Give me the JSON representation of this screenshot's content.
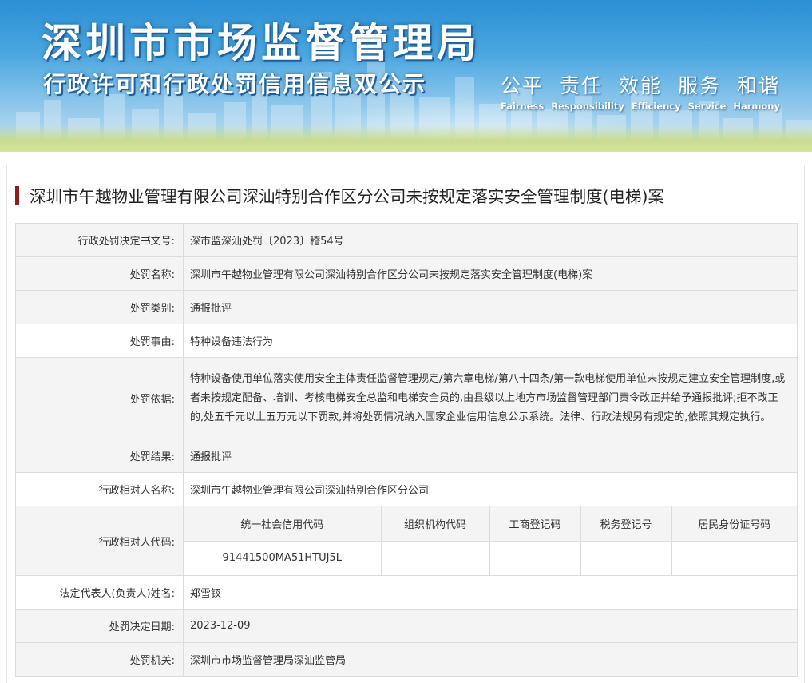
{
  "banner": {
    "title": "深圳市市场监督管理局",
    "subtitle": "行政许可和行政处罚信用信息双公示",
    "values": [
      {
        "zh": "公平",
        "en": "Fairness"
      },
      {
        "zh": "责任",
        "en": "Responsibility"
      },
      {
        "zh": "效能",
        "en": "Efficiency"
      },
      {
        "zh": "服务",
        "en": "Service"
      },
      {
        "zh": "和谐",
        "en": "Harmony"
      }
    ]
  },
  "case": {
    "title": "深圳市午越物业管理有限公司深汕特别合作区分公司未按规定落实安全管理制度(电梯)案"
  },
  "fields": {
    "doc_no": {
      "label": "行政处罚决定书文号:",
      "value": "深市监深汕处罚〔2023〕稽54号"
    },
    "name": {
      "label": "处罚名称:",
      "value": "深圳市午越物业管理有限公司深汕特别合作区分公司未按规定落实安全管理制度(电梯)案"
    },
    "category": {
      "label": "处罚类别:",
      "value": "通报批评"
    },
    "reason": {
      "label": "处罚事由:",
      "value": "特种设备违法行为"
    },
    "basis": {
      "label": "处罚依据:",
      "value": "特种设备使用单位落实使用安全主体责任监督管理规定/第六章电梯/第八十四条/第一款电梯使用单位未按规定建立安全管理制度,或者未按规定配备、培训、考核电梯安全总监和电梯安全员的,由县级以上地方市场监督管理部门责令改正并给予通报批评;拒不改正的,处五千元以上五万元以下罚款,并将处罚情况纳入国家企业信用信息公示系统。法律、行政法规另有规定的,依照其规定执行。"
    },
    "result": {
      "label": "处罚结果:",
      "value": "通报批评"
    },
    "party_name": {
      "label": "行政相对人名称:",
      "value": "深圳市午越物业管理有限公司深汕特别合作区分公司"
    },
    "party_code": {
      "label": "行政相对人代码:",
      "headers": [
        "统一社会信用代码",
        "组织机构代码",
        "工商登记码",
        "税务登记号",
        "居民身份证号码"
      ],
      "values": [
        "91441500MA51HTUJ5L",
        "",
        "",
        "",
        ""
      ]
    },
    "legal_rep": {
      "label": "法定代表人(负责人)姓名:",
      "value": "郑雪钗"
    },
    "decision_date": {
      "label": "处罚决定日期:",
      "value": "2023-12-09"
    },
    "authority": {
      "label": "处罚机关:",
      "value": "深圳市市场监督管理局深汕监管局"
    }
  }
}
